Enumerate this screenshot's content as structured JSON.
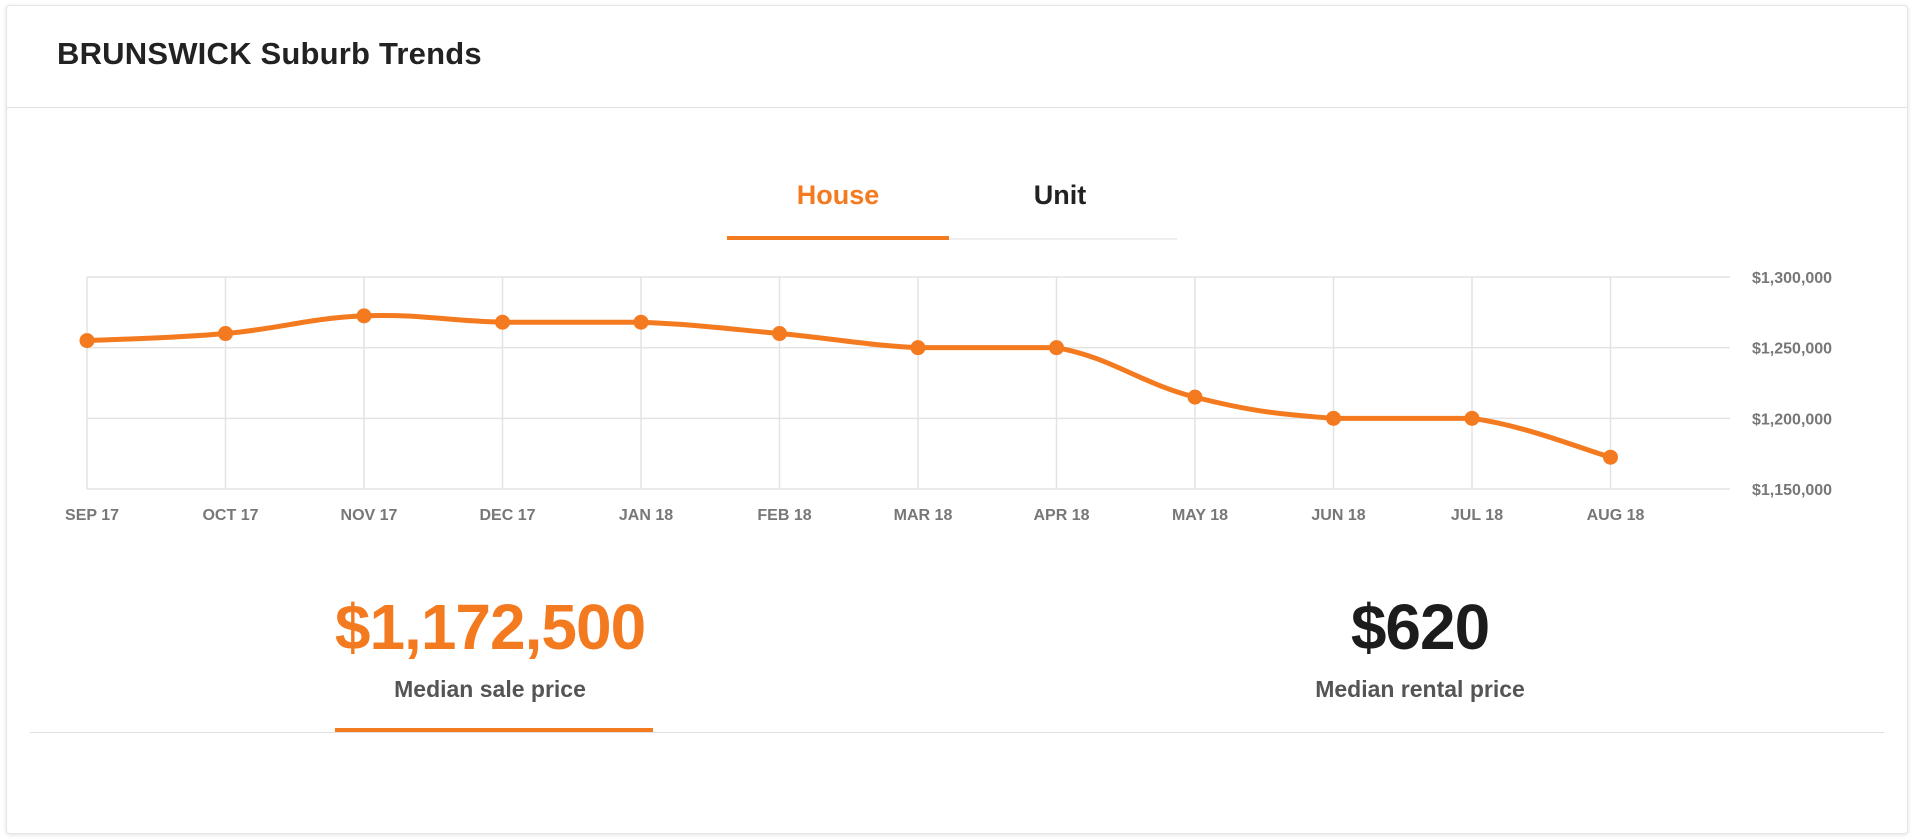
{
  "header": {
    "title": "BRUNSWICK Suburb Trends"
  },
  "tabs": [
    {
      "label": "House",
      "active": true
    },
    {
      "label": "Unit",
      "active": false
    }
  ],
  "stats": {
    "sale": {
      "value": "$1,172,500",
      "label": "Median sale price"
    },
    "rent": {
      "value": "$620",
      "label": "Median rental price"
    }
  },
  "colors": {
    "accent": "#f47a20",
    "grid": "#e3e3e3",
    "axis_text": "#777777"
  },
  "chart_data": {
    "type": "line",
    "categories": [
      "SEP 17",
      "OCT 17",
      "NOV 17",
      "DEC 17",
      "JAN 18",
      "FEB 18",
      "MAR 18",
      "APR 18",
      "MAY 18",
      "JUN 18",
      "JUL 18",
      "AUG 18"
    ],
    "series": [
      {
        "values": [
          1255000,
          1260000,
          1272500,
          1268000,
          1268000,
          1260000,
          1250000,
          1250000,
          1215000,
          1200000,
          1200000,
          1172500
        ]
      }
    ],
    "ylim": [
      1150000,
      1300000
    ],
    "yticks": [
      1300000,
      1250000,
      1200000,
      1150000
    ],
    "ytick_labels": [
      "$1,300,000",
      "$1,250,000",
      "$1,200,000",
      "$1,150,000"
    ],
    "grid": true
  }
}
